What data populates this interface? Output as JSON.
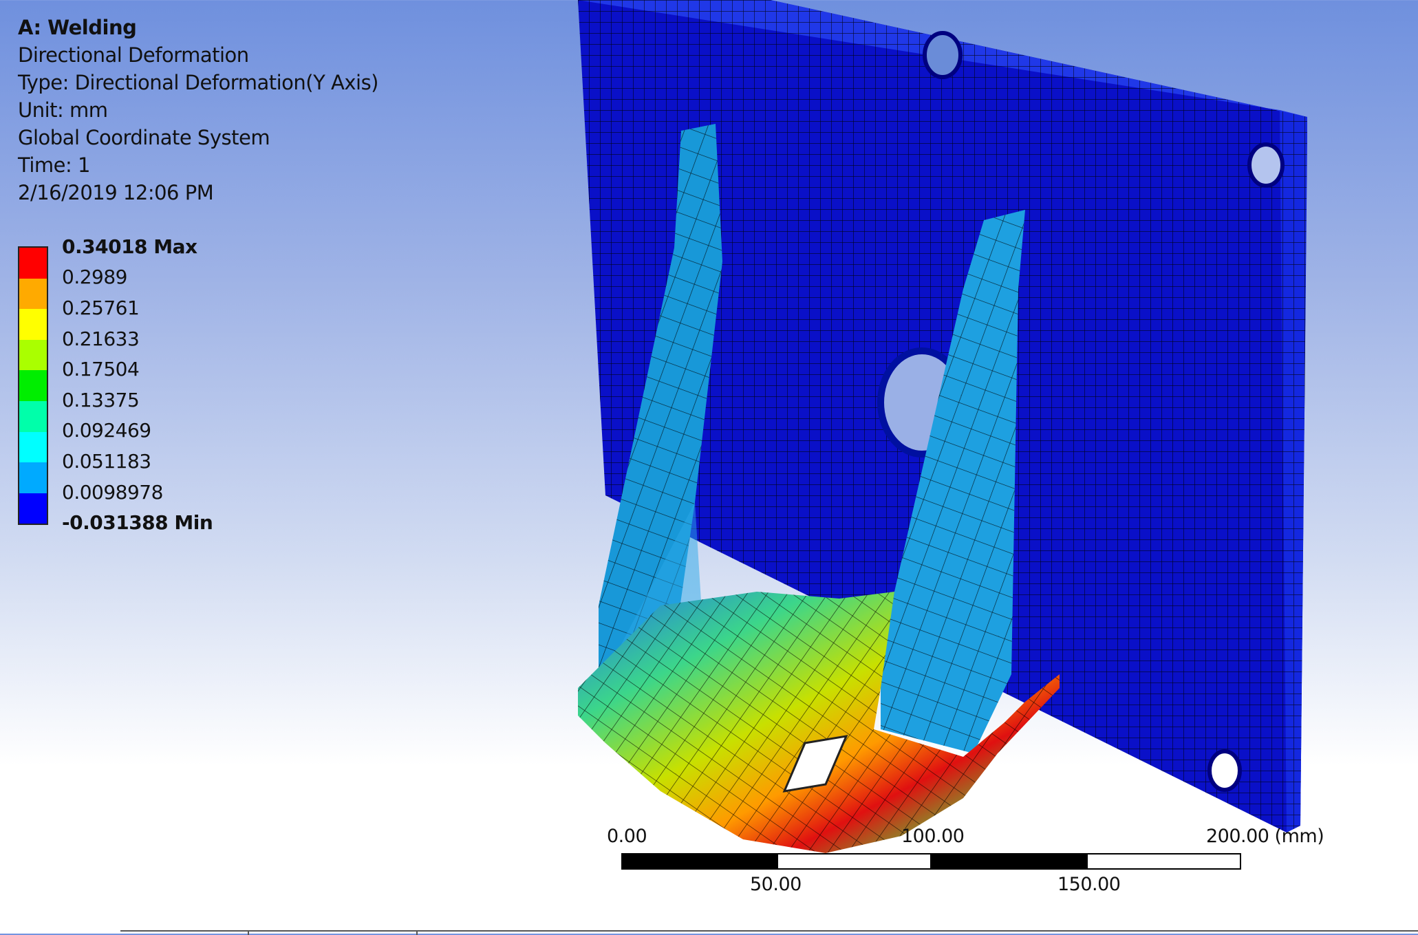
{
  "info": {
    "title": "A: Welding",
    "result": "Directional Deformation",
    "type": "Type: Directional Deformation(Y Axis)",
    "unit": "Unit: mm",
    "coord": "Global Coordinate System",
    "time": "Time: 1",
    "date": "2/16/2019 12:06 PM"
  },
  "legend": {
    "max_label": "0.34018 Max",
    "v1": "0.2989",
    "v2": "0.25761",
    "v3": "0.21633",
    "v4": "0.17504",
    "v5": "0.13375",
    "v6": "0.092469",
    "v7": "0.051183",
    "v8": "0.0098978",
    "min_label": "-0.031388 Min",
    "colors": [
      "#ff0000",
      "#ffaa00",
      "#ffff00",
      "#aaff00",
      "#00ee00",
      "#00ffaa",
      "#00ffff",
      "#00aaff",
      "#0000ff"
    ]
  },
  "scale": {
    "l0": "0.00",
    "l50": "50.00",
    "l100": "100.00",
    "l150": "150.00",
    "l200": "200.00 (mm)"
  }
}
